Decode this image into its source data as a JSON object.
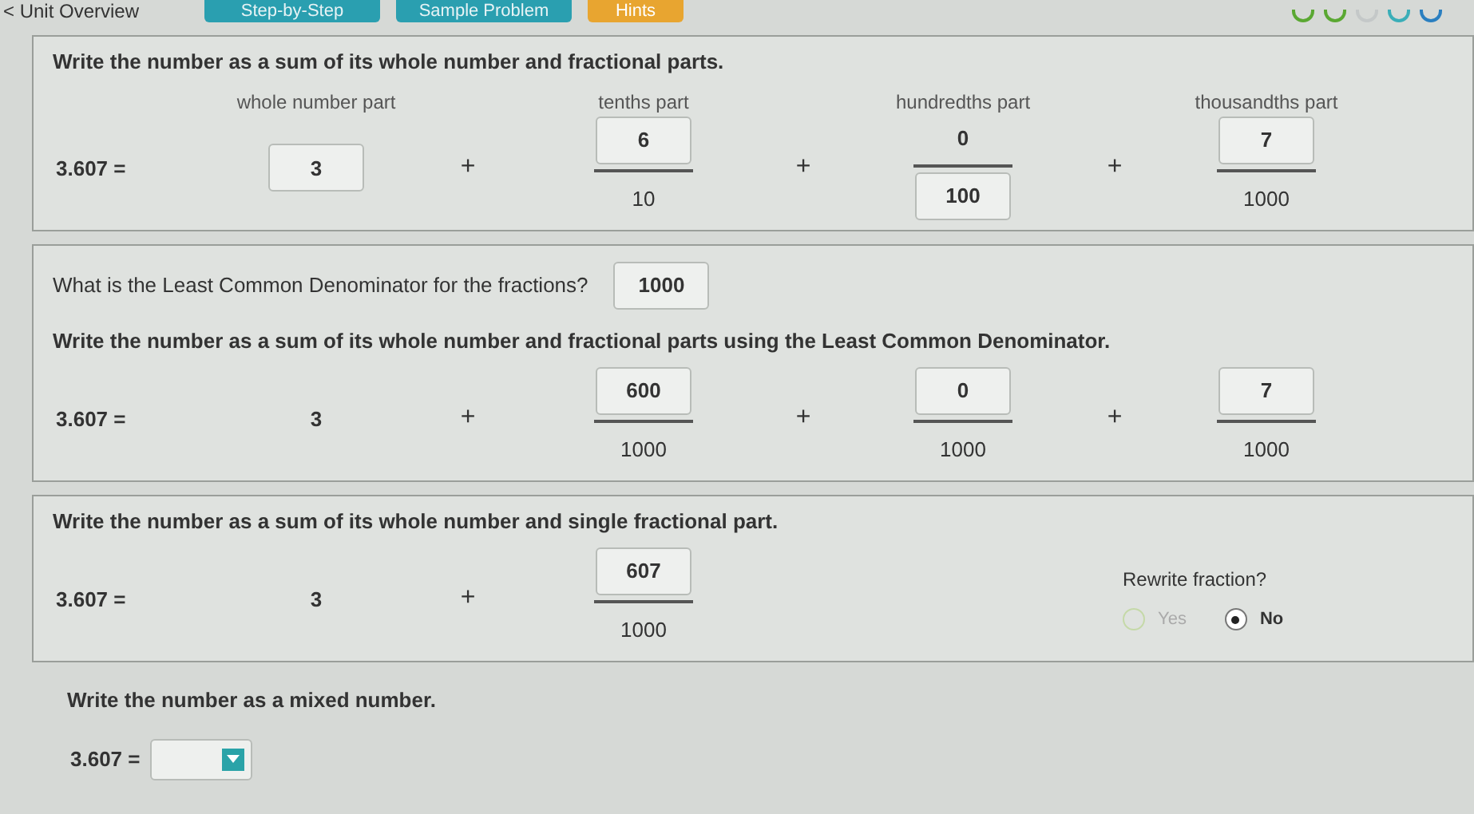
{
  "nav": {
    "back": "< Unit Overview",
    "tabs": [
      {
        "label": "Step-by-Step",
        "kind": "primary"
      },
      {
        "label": "Sample Problem",
        "kind": "primary"
      },
      {
        "label": "Hints",
        "kind": "hint"
      }
    ],
    "progress": [
      {
        "color": "#5aa832"
      },
      {
        "color": "#5aa832"
      },
      {
        "color": "#c4c8c8"
      },
      {
        "color": "#3aaeb8"
      },
      {
        "color": "#2a7fc0"
      }
    ]
  },
  "sections": [
    {
      "framed": true,
      "prompt": "Write the number as a sum of its whole number and fractional parts.",
      "lhs": "3.607 =",
      "terms": [
        {
          "kind": "whole",
          "label": "whole number part",
          "value": "3",
          "boxed": true
        },
        {
          "kind": "fraction",
          "operator": "+",
          "label": "tenths part",
          "numerator": "6",
          "denominator": "10",
          "numerator_boxed": true,
          "denominator_boxed": false
        },
        {
          "kind": "fraction",
          "operator": "+",
          "label": "hundredths part",
          "numerator": "0",
          "denominator": "100",
          "numerator_boxed": false,
          "denominator_boxed": true
        },
        {
          "kind": "fraction",
          "operator": "+",
          "label": "thousandths part",
          "numerator": "7",
          "denominator": "1000",
          "numerator_boxed": true,
          "denominator_boxed": false
        }
      ]
    },
    {
      "framed": true,
      "question": {
        "text": "What is the Least Common Denominator for the fractions?",
        "answer": "1000"
      },
      "prompt": "Write the number as a sum of its whole number and fractional parts using the Least Common Denominator.",
      "lhs": "3.607 =",
      "terms": [
        {
          "kind": "whole",
          "value": "3",
          "boxed": false
        },
        {
          "kind": "fraction",
          "operator": "+",
          "numerator": "600",
          "denominator": "1000",
          "numerator_boxed": true,
          "denominator_boxed": false
        },
        {
          "kind": "fraction",
          "operator": "+",
          "numerator": "0",
          "denominator": "1000",
          "numerator_boxed": true,
          "denominator_boxed": false
        },
        {
          "kind": "fraction",
          "operator": "+",
          "numerator": "7",
          "denominator": "1000",
          "numerator_boxed": true,
          "denominator_boxed": false
        }
      ]
    },
    {
      "framed": true,
      "prompt": "Write the number as a sum of its whole number and single fractional part.",
      "lhs": "3.607 =",
      "terms": [
        {
          "kind": "whole",
          "value": "3",
          "boxed": false
        },
        {
          "kind": "fraction",
          "operator": "+",
          "numerator": "607",
          "denominator": "1000",
          "numerator_boxed": true,
          "denominator_boxed": false
        }
      ],
      "rewrite": {
        "question": "Rewrite fraction?",
        "options": [
          {
            "label": "Yes",
            "selected": false,
            "disabled": true
          },
          {
            "label": "No",
            "selected": true,
            "disabled": false
          }
        ]
      }
    },
    {
      "framed": false,
      "prompt": "Write the number as a mixed number.",
      "lhs": "3.607 =",
      "dropdown": {
        "open": false
      }
    }
  ]
}
